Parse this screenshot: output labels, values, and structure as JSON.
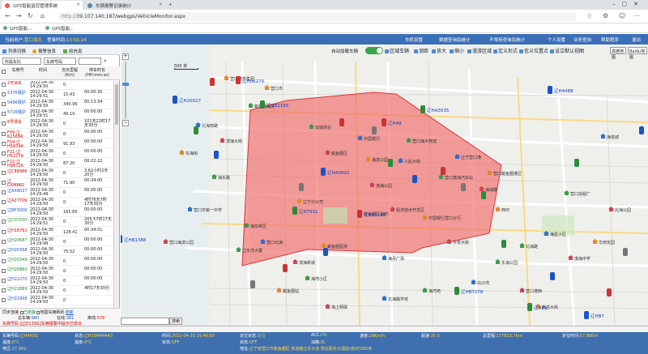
{
  "browser": {
    "tabs": [
      {
        "title": "GPS智能监控管理系统",
        "active": true
      },
      {
        "title": "车辆报警记录统计",
        "active": false
      }
    ],
    "new_tab": "+",
    "url_proto": "http://",
    "url_rest": "39.107.140.187/webgps/VehicleMonitor.aspx",
    "bookmarks": [
      "GPS智能...",
      "GPS智能..."
    ]
  },
  "app": {
    "current_user_label": "当前用户:",
    "current_user": "营口海大",
    "login_time_label": "登录时间:",
    "login_time": "13:55:24",
    "menu": [
      "车机设置",
      "数据查询及统计",
      "不常用查询及统计",
      "个人设置",
      "业务查询",
      "帮助程序",
      "退出"
    ]
  },
  "left": {
    "tools": [
      "列表切换",
      "报警信息",
      "给信息"
    ],
    "filter_group": "所属车队",
    "filter_field": "车牌号码",
    "table_headers": [
      "车牌号",
      "时间",
      "当日里程(Km)",
      "停车时长(HH:mm:ss)"
    ],
    "rows": [
      {
        "plate": "2号场车",
        "time": "2022-04-30 14:29:50",
        "mileage": "0",
        "stop": "",
        "color": "#c00"
      },
      {
        "plate": "5376银护",
        "time": "2022-04-30 14:29:51",
        "mileage": "15.43",
        "stop": "00:00:30",
        "color": "#1a54c8"
      },
      {
        "plate": "5496银护",
        "time": "2022-04-30 14:29:50",
        "mileage": "340.96",
        "stop": "00:13:34",
        "color": "#1a54c8"
      },
      {
        "plate": "5726银护",
        "time": "2022-04-30 14:29:51",
        "mileage": "49.19",
        "stop": "00:00:00",
        "color": "#1a54c8"
      },
      {
        "plate": "6号场车",
        "time": "2022-04-30 14:29:50",
        "mileage": "0",
        "stop": "101天22时17天30分",
        "color": "#c00"
      },
      {
        "plate": "F09-辽K2568A",
        "time": "2022-04-30 14:29:50",
        "mileage": "0",
        "stop": "00:00:00",
        "color": "#c00"
      },
      {
        "plate": "F19-辽H5674A",
        "time": "2022-04-30 14:29:50",
        "mileage": "91.93",
        "stop": "00:00:00",
        "color": "#c00"
      },
      {
        "plate": "F21-辽H5277A",
        "time": "2022-04-30 14:29:50",
        "mileage": "0",
        "stop": "00:00:00",
        "color": "#c00"
      },
      {
        "plate": "F22-辽H9872A",
        "time": "2022-04-30 14:29:50",
        "mileage": "87.20",
        "stop": "00:22:22",
        "color": "#c00"
      },
      {
        "plate": "辽C88986",
        "time": "2022-04-30 14:29:50",
        "mileage": "0",
        "stop": "3.62小时2天20分",
        "color": "#c00"
      },
      {
        "plate": "辽DXM882",
        "time": "2022-04-30 14:29:50",
        "mileage": "71.90",
        "stop": "00:34:00",
        "color": "#c00"
      },
      {
        "plate": "辽AX8027",
        "time": "2022-04-30 14:29:49",
        "mileage": "0",
        "stop": "00:00:00",
        "color": "#1a54c8"
      },
      {
        "plate": "辽A27709",
        "time": "2022-04-30 14:29:50",
        "mileage": "0",
        "stop": "4时76天7时17天30分",
        "color": "#c00"
      },
      {
        "plate": "辽BP3009",
        "time": "2022-04-30 14:29:50",
        "mileage": "165.85",
        "stop": "00:00:00",
        "color": "#1a54c8"
      },
      {
        "plate": "辽CD7097",
        "time": "2022-04-30 14:29:51",
        "mileage": "0",
        "stop": "205.57时17天30分",
        "color": "#1a8a2a"
      },
      {
        "plate": "辽H16761",
        "time": "2022-04-30 14:29:50",
        "mileage": "128.41",
        "stop": "00:34:01",
        "color": "#c00"
      },
      {
        "plate": "辽H20687",
        "time": "2022-04-30 14:29:49",
        "mileage": "0",
        "stop": "00:00:00",
        "color": "#1a8a2a"
      },
      {
        "plate": "辽H20398",
        "time": "2022-04-30 14:29:50",
        "mileage": "70.52",
        "stop": "00:00:00",
        "color": "#1a54c8"
      },
      {
        "plate": "辽H20349",
        "time": "2022-04-30 14:29:50",
        "mileage": "0",
        "stop": "00:00:00",
        "color": "#1a8a2a"
      },
      {
        "plate": "辽H20860",
        "time": "2022-04-30 14:29:50",
        "mileage": "0",
        "stop": "00:00:00",
        "color": "#1a8a2a"
      },
      {
        "plate": "辽H22270",
        "time": "2022-04-30 14:29:50",
        "mileage": "0",
        "stop": "00:00:00",
        "color": "#1a54c8"
      },
      {
        "plate": "辽H22889",
        "time": "2022-04-30 14:29:50",
        "mileage": "0",
        "stop": "4时17天30分",
        "color": "#1a8a2a"
      },
      {
        "plate": "辽H22998",
        "time": "2022-04-30 14:29:50",
        "mileage": "0",
        "stop": "",
        "color": "#1a54c8"
      }
    ],
    "footer": {
      "line1": "同步连接",
      "check1": "已连接",
      "check2": "地图车辆刷新",
      "refresh": "刷新",
      "total_label": "总车辆:",
      "total": "960",
      "online_label": "在线:",
      "online": "381",
      "offline_label": "离线:",
      "offline": "579"
    },
    "alert_text": "车牌号码 [辽D133G]车辆报警中提示已发出"
  },
  "map": {
    "auto_load_label": "自动加载车辆",
    "toolbar": [
      "区域车辆",
      "测距",
      "放大",
      "缩小",
      "漫游区域",
      "定义形式",
      "信义位置点",
      "设立默认视图"
    ],
    "map_type": "高德地图",
    "map_type2": "Baidu地图",
    "scale_label": "500 米",
    "search_placeholder": "",
    "search_button": "搜索",
    "vehicle_labels": [
      "辽H06270",
      "辽H20027",
      "辽HB2165",
      "辽HA3035",
      "辽H4488",
      "辽H49",
      "辽HA0892",
      "辽H7531",
      "辽HB3186",
      "辽HB1388",
      "辽HB7278",
      "辽H81",
      "辽HB7"
    ],
    "place_labels": [
      "营口港务集团",
      "鲅鱼圈海关",
      "北海南路",
      "滨海大街",
      "营口市",
      "双城商业",
      "中国银行",
      "鲅鱼圈区",
      "海滨公园",
      "营口海大物流",
      "人民大街",
      "渤海公园",
      "辽宁分公司",
      "海东新区",
      "营口北海",
      "滨海新城",
      "鲅鱼圈医院",
      "海湾小区",
      "鲅鱼圈区政府",
      "经济技术开发区",
      "中国银行营口分行",
      "营口渤海汽车站",
      "辽宁营口港",
      "海城路",
      "西环",
      "北海路",
      "海星小区",
      "渤海中学",
      "华南花园",
      "东海公园",
      "白沙湾",
      "营口港西",
      "熊岳大街",
      "海东路",
      "营口市第一中学",
      "营口海滨公园",
      "东海街",
      "海湾苑",
      "北海路学校",
      "海上明珠",
      "鲅鱼圈站",
      "辽东湾大厦",
      "海月广场",
      "平安大街",
      "营口鲅鱼圈港区",
      "营口造船厂",
      "海悦城",
      "北海公园"
    ]
  },
  "status": {
    "row1": [
      {
        "label": "车辆号码:",
        "value": "辽H4H3G"
      },
      {
        "label": "时间:",
        "value": "2022-04-30 15:46:50"
      },
      {
        "label": "ACC:",
        "value": "ON"
      },
      {
        "label": "速度:",
        "value": "29Km/h"
      },
      {
        "label": "超速:",
        "value": "35",
        "extra": "0"
      },
      {
        "label": "总里程:",
        "value": "177823.7Km"
      },
      {
        "label": "定位时间:",
        "value": "57.88Km"
      }
    ],
    "row2": [
      {
        "label": "温度:",
        "value": "0°C"
      },
      {
        "label": "状态:",
        "value": "辽H33M44443"
      },
      {
        "label": "定位状态:",
        "value": "定位"
      },
      {
        "label": "状态:",
        "value": "OFF"
      },
      {
        "label": "油箱:",
        "value": "0L"
      }
    ],
    "row3": [
      {
        "label": "电压:",
        "value": "27.96V"
      },
      {
        "label": "温度:",
        "value": "0°C"
      },
      {
        "label": "状态:",
        "value": "OFF"
      },
      {
        "label": "地址:",
        "value": "辽宁省营口市鲅鱼圈区 铁道路辽东大道 附近距东大酒店(南)约380米"
      }
    ]
  },
  "colors": {
    "appbar": "#3b6fb5",
    "geofence_fill": "#f06a6a",
    "geofence_stroke": "#d9363e",
    "toggle_on": "#3ba34a"
  }
}
